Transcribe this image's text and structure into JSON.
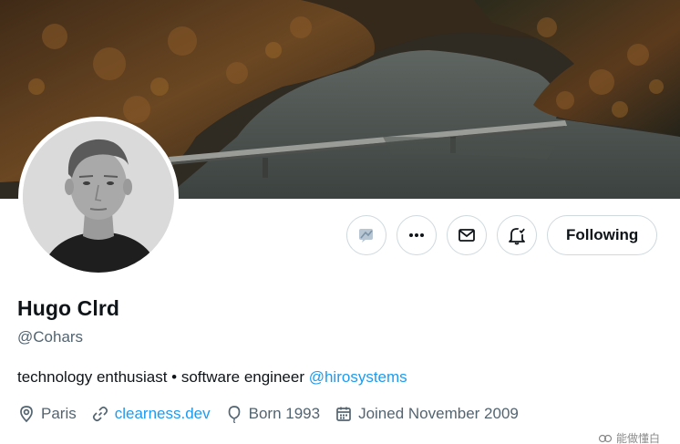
{
  "profile": {
    "name": "Hugo Clrd",
    "handle": "@Cohars",
    "bio_text": "technology enthusiast • software engineer ",
    "bio_mention": "@hirosystems",
    "location": "Paris",
    "website": "clearness.dev",
    "born": "Born 1993",
    "joined": "Joined November 2009"
  },
  "actions": {
    "following_label": "Following"
  },
  "icons": {
    "grok": "grok-icon",
    "more": "more-icon",
    "message": "envelope-icon",
    "notifications": "bell-check-icon",
    "location": "location-pin-icon",
    "website": "link-icon",
    "born": "balloon-icon",
    "joined": "calendar-icon"
  },
  "colors": {
    "link": "#1d9bf0",
    "secondary_text": "#536471",
    "primary_text": "#0f1419",
    "border": "#cfd9de"
  },
  "watermark": {
    "text": "能做懂白"
  }
}
